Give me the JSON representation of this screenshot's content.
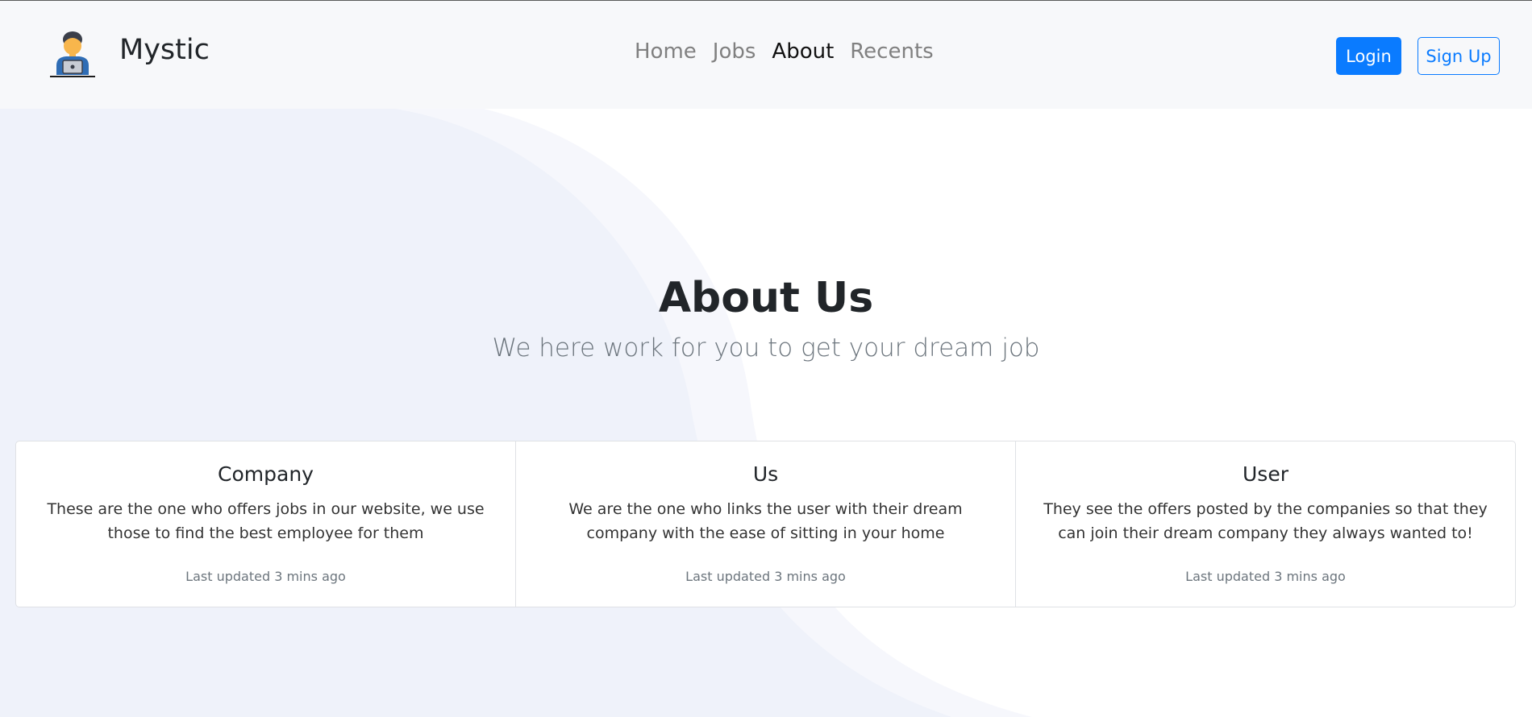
{
  "brand": {
    "name": "Mystic",
    "logo_icon": "freelancer-laptop-icon"
  },
  "nav": {
    "links": [
      {
        "label": "Home",
        "active": false
      },
      {
        "label": "Jobs",
        "active": false
      },
      {
        "label": "About",
        "active": true
      },
      {
        "label": "Recents",
        "active": false
      }
    ]
  },
  "auth": {
    "login_label": "Login",
    "signup_label": "Sign Up"
  },
  "hero": {
    "title": "About Us",
    "subtitle": "We here work for you to get your dream job"
  },
  "cards": [
    {
      "title": "Company",
      "text": "These are the one who offers jobs in our website, we use those to find the best employee for them",
      "meta": "Last updated 3 mins ago"
    },
    {
      "title": "Us",
      "text": "We are the one who links the user with their dream company with the ease of sitting in your home",
      "meta": "Last updated 3 mins ago"
    },
    {
      "title": "User",
      "text": "They see the offers posted by the companies so that they can join their dream company they always wanted to!",
      "meta": "Last updated 3 mins ago"
    }
  ],
  "colors": {
    "primary": "#0a7bff",
    "navbar_bg": "#f7f8fa",
    "shape_dark": "#eff2fa",
    "shape_light": "#f6f7fc"
  }
}
